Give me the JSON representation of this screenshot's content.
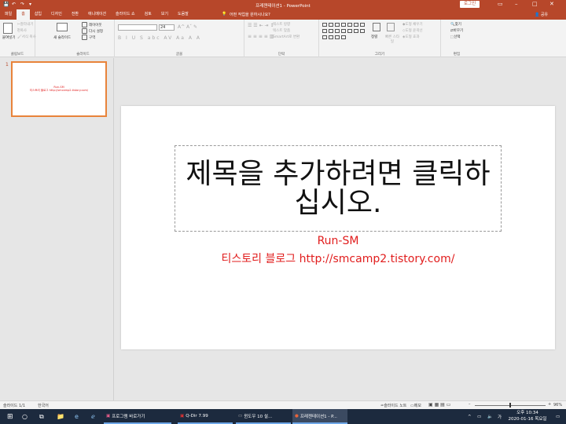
{
  "titlebar": {
    "title": "프레젠테이션1 - PowerPoint",
    "login_label": "로그인"
  },
  "ribbon_tabs": [
    "파일",
    "홈",
    "삽입",
    "디자인",
    "전환",
    "애니메이션",
    "슬라이드 쇼",
    "검토",
    "보기",
    "도움말"
  ],
  "tell_me": "어떤 작업을 원하시나요?",
  "share_label": "공유",
  "clipboard": {
    "paste": "붙여넣기",
    "cut": "잘라내기",
    "copy": "복사",
    "format_painter": "서식 복사",
    "group": "클립보드"
  },
  "slides_group": {
    "new_slide": "새 슬라이드",
    "layout": "레이아웃",
    "reset": "다시 설정",
    "section": "구역",
    "group": "슬라이드"
  },
  "font_group": {
    "size": "24",
    "group": "글꼴"
  },
  "paragraph_group": {
    "text_direction": "텍스트 방향",
    "align_text": "텍스트 맞춤",
    "smartart": "SmartArt로 변환",
    "group": "단락"
  },
  "drawing_group": {
    "arrange": "정렬",
    "quick_styles": "빠른 스타일",
    "fill": "도형 채우기",
    "outline": "도형 윤곽선",
    "effects": "도형 효과",
    "group": "그리기"
  },
  "editing_group": {
    "find": "찾기",
    "replace": "바꾸기",
    "select": "선택",
    "group": "편집"
  },
  "thumbnail": {
    "number": "1",
    "line1": "Run-SM",
    "line2": "티스토리 블로그 http://smcamp2.tistory.com/"
  },
  "slide": {
    "title_placeholder": "제목을 추가하려면 클릭하십시오.",
    "subtitle_line1": "Run-SM",
    "subtitle_line2": "티스토리 블로그 http://smcamp2.tistory.com/",
    "accent_color": "#e11d1d"
  },
  "statusbar": {
    "slide_counter": "슬라이드 1/1",
    "language": "한국어",
    "notes": "슬라이드 노트",
    "comments": "메모",
    "zoom": "96%"
  },
  "taskbar": {
    "app1": "프로그램 바로가기",
    "app2": "Q-Dir 7.99",
    "app3": "윈도우 10 설...",
    "app4": "프레젠테이션1 - P...",
    "ime": "가",
    "time": "오후 10:34",
    "date": "2020-01-16 목요일"
  }
}
